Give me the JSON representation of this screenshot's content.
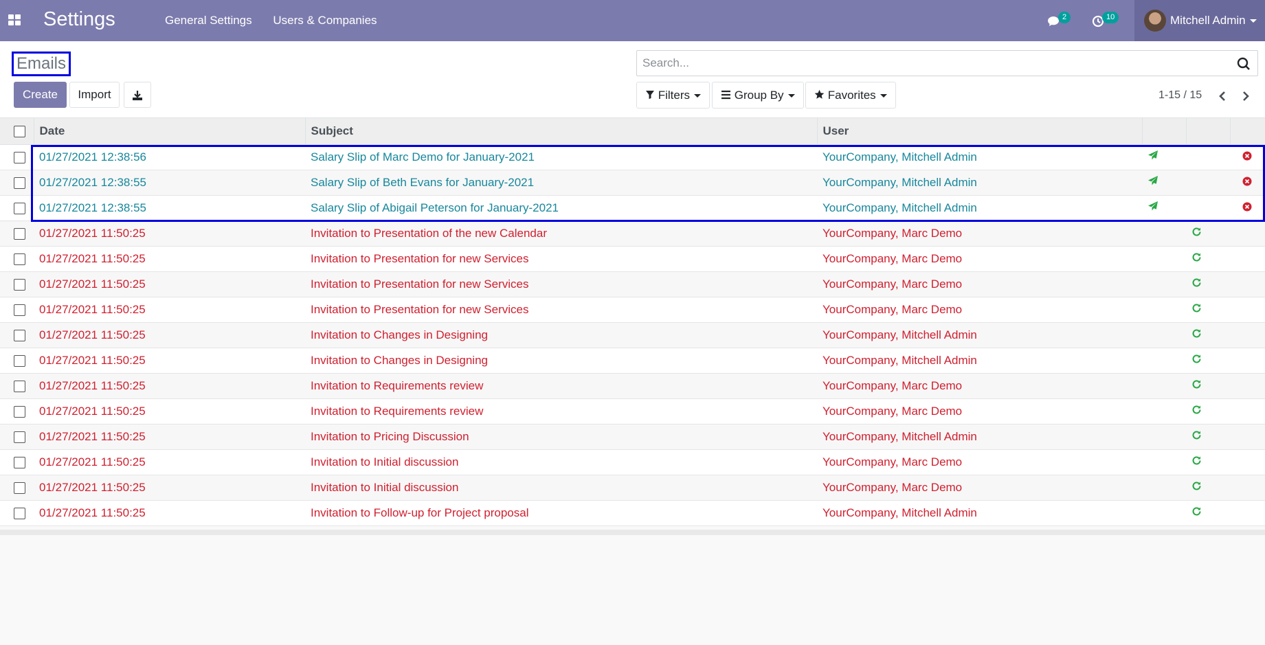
{
  "app": {
    "title": "Settings",
    "menu": [
      "General Settings",
      "Users & Companies"
    ],
    "messages_badge": "2",
    "activities_badge": "10",
    "user_name": "Mitchell Admin"
  },
  "control": {
    "page_title": "Emails",
    "create_label": "Create",
    "import_label": "Import",
    "search_placeholder": "Search...",
    "filters_label": "Filters",
    "groupby_label": "Group By",
    "favorites_label": "Favorites",
    "pager": "1-15 / 15"
  },
  "table": {
    "headers": [
      "Date",
      "Subject",
      "User"
    ],
    "rows": [
      {
        "date": "01/27/2021 12:38:56",
        "subject": "Salary Slip of Marc Demo for January-2021",
        "user": "YourCompany, Mitchell Admin",
        "state": "sent"
      },
      {
        "date": "01/27/2021 12:38:55",
        "subject": "Salary Slip of Beth Evans for January-2021",
        "user": "YourCompany, Mitchell Admin",
        "state": "sent"
      },
      {
        "date": "01/27/2021 12:38:55",
        "subject": "Salary Slip of Abigail Peterson for January-2021",
        "user": "YourCompany, Mitchell Admin",
        "state": "sent"
      },
      {
        "date": "01/27/2021 11:50:25",
        "subject": "Invitation to Presentation of the new Calendar",
        "user": "YourCompany, Marc Demo",
        "state": "exception"
      },
      {
        "date": "01/27/2021 11:50:25",
        "subject": "Invitation to Presentation for new Services",
        "user": "YourCompany, Marc Demo",
        "state": "exception"
      },
      {
        "date": "01/27/2021 11:50:25",
        "subject": "Invitation to Presentation for new Services",
        "user": "YourCompany, Marc Demo",
        "state": "exception"
      },
      {
        "date": "01/27/2021 11:50:25",
        "subject": "Invitation to Presentation for new Services",
        "user": "YourCompany, Marc Demo",
        "state": "exception"
      },
      {
        "date": "01/27/2021 11:50:25",
        "subject": "Invitation to Changes in Designing",
        "user": "YourCompany, Mitchell Admin",
        "state": "exception"
      },
      {
        "date": "01/27/2021 11:50:25",
        "subject": "Invitation to Changes in Designing",
        "user": "YourCompany, Mitchell Admin",
        "state": "exception"
      },
      {
        "date": "01/27/2021 11:50:25",
        "subject": "Invitation to Requirements review",
        "user": "YourCompany, Marc Demo",
        "state": "exception"
      },
      {
        "date": "01/27/2021 11:50:25",
        "subject": "Invitation to Requirements review",
        "user": "YourCompany, Marc Demo",
        "state": "exception"
      },
      {
        "date": "01/27/2021 11:50:25",
        "subject": "Invitation to Pricing Discussion",
        "user": "YourCompany, Mitchell Admin",
        "state": "exception"
      },
      {
        "date": "01/27/2021 11:50:25",
        "subject": "Invitation to Initial discussion",
        "user": "YourCompany, Marc Demo",
        "state": "exception"
      },
      {
        "date": "01/27/2021 11:50:25",
        "subject": "Invitation to Initial discussion",
        "user": "YourCompany, Marc Demo",
        "state": "exception"
      },
      {
        "date": "01/27/2021 11:50:25",
        "subject": "Invitation to Follow-up for Project proposal",
        "user": "YourCompany, Mitchell Admin",
        "state": "exception"
      }
    ]
  },
  "colors": {
    "navbar": "#7c7bad",
    "sent_text": "#17879c",
    "error_text": "#d0202f",
    "send_icon": "#28a745",
    "cancel_icon": "#d0202f",
    "highlight": "#0000e0"
  },
  "icons": {
    "sent_row": [
      "send-icon",
      "cancel-icon"
    ],
    "exception_row": [
      "retry-icon"
    ]
  }
}
